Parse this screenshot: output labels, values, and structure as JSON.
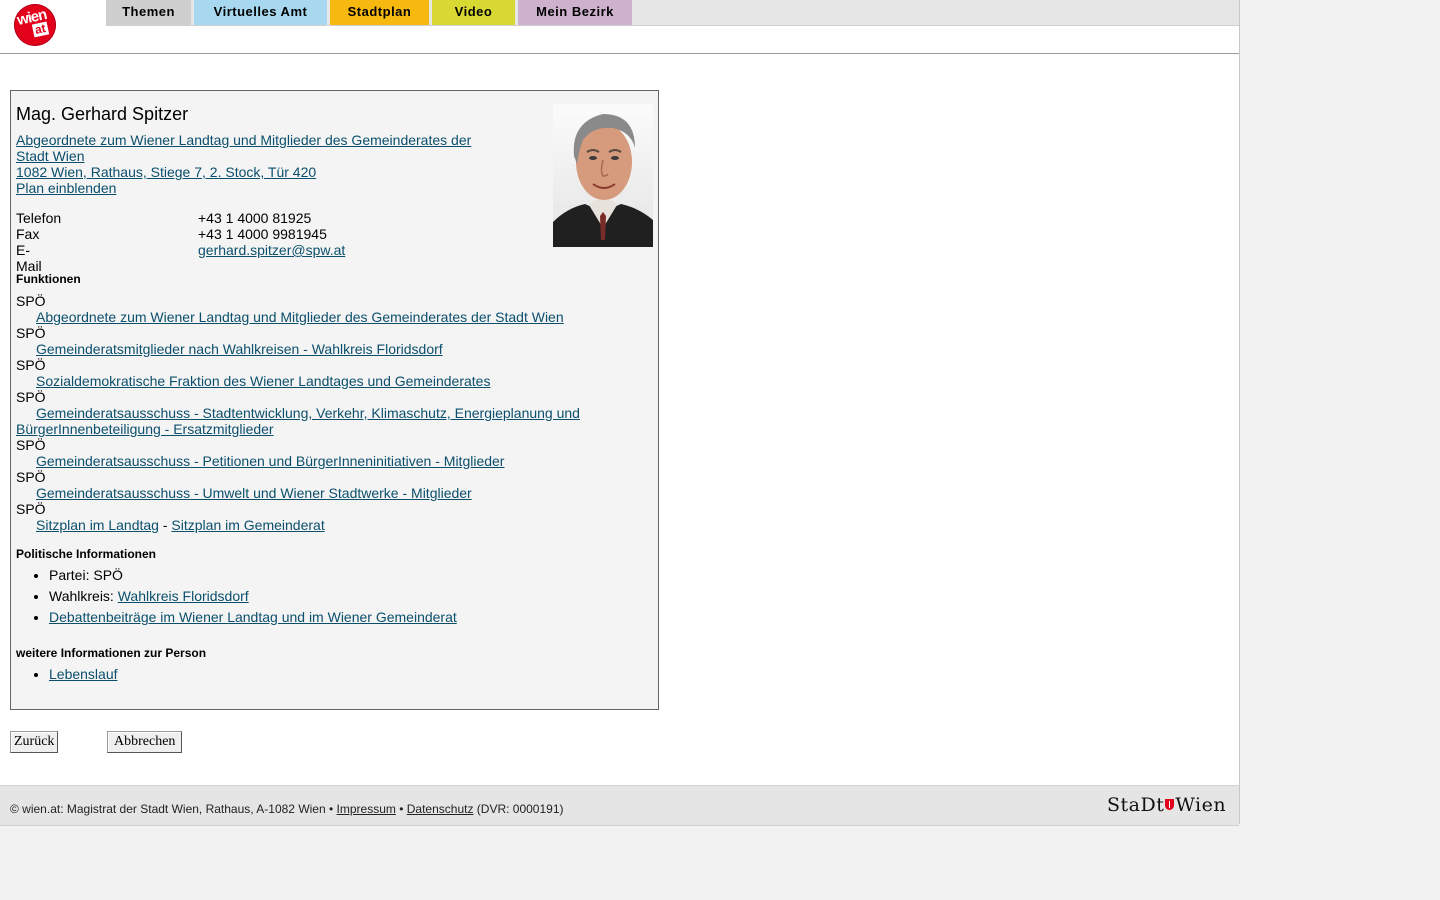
{
  "header": {
    "logo": {
      "line1": "wien",
      "line2": "at"
    },
    "nav": [
      {
        "label": "Themen",
        "color": "#cfcfcf"
      },
      {
        "label": "Virtuelles Amt",
        "color": "#a8d8f0"
      },
      {
        "label": "Stadtplan",
        "color": "#f7b90f"
      },
      {
        "label": "Video",
        "color": "#d7d932"
      },
      {
        "label": "Mein Bezirk",
        "color": "#ceb2cd"
      }
    ]
  },
  "person": {
    "name": "Mag. Gerhard Spitzer",
    "org_link": "Abgeordnete zum Wiener Landtag und Mitglieder des Gemeinderates der Stadt Wien",
    "address_link": "1082 Wien, Rathaus, Stiege 7, 2. Stock, Tür 420",
    "plan_link": "Plan einblenden",
    "contact": [
      {
        "label": "Telefon",
        "value": "+43 1 4000 81925"
      },
      {
        "label": "Fax",
        "value": "+43 1 4000 9981945"
      },
      {
        "label": "E-Mail",
        "value": "gerhard.spitzer@spw.at"
      }
    ]
  },
  "funktionen": {
    "heading": "Funktionen",
    "items": [
      {
        "party": "SPÖ",
        "link": "Abgeordnete zum Wiener Landtag und Mitglieder des Gemeinderates der Stadt Wien"
      },
      {
        "party": "SPÖ",
        "link": "Gemeinderatsmitglieder nach Wahlkreisen - Wahlkreis Floridsdorf"
      },
      {
        "party": "SPÖ",
        "link": "Sozialdemokratische Fraktion des Wiener Landtages und Gemeinderates"
      },
      {
        "party": "SPÖ",
        "link": "Gemeinderatsausschuss - Stadtentwicklung, Verkehr, Klimaschutz, Energieplanung und BürgerInnenbeteiligung - Ersatzmitglieder"
      },
      {
        "party": "SPÖ",
        "link": "Gemeinderatsausschuss - Petitionen und BürgerInneninitiativen - Mitglieder"
      },
      {
        "party": "SPÖ",
        "link": "Gemeinderatsausschuss - Umwelt und Wiener Stadtwerke - Mitglieder"
      }
    ],
    "last": {
      "party": "SPÖ",
      "link1": "Sitzplan im Landtag",
      "sep": " - ",
      "link2": "Sitzplan im Gemeinderat"
    }
  },
  "politisch": {
    "heading": "Politische Informationen",
    "partei_label": "Partei: SPÖ",
    "wahlkreis_label": "Wahlkreis: ",
    "wahlkreis_link": "Wahlkreis Floridsdorf",
    "debatten_link": "Debattenbeiträge im Wiener Landtag und im Wiener Gemeinderat"
  },
  "weitere": {
    "heading": "weitere Informationen zur Person",
    "lebenslauf_link": "Lebenslauf"
  },
  "buttons": {
    "back": "Zurück",
    "cancel": "Abbrechen"
  },
  "footer": {
    "text": "© wien.at: Magistrat der Stadt Wien, Rathaus, A-1082 Wien • ",
    "impressum": "Impressum",
    "sep": " • ",
    "datenschutz": "Datenschutz",
    "dvr": " (DVR: 0000191)",
    "logo_left": "StaDt",
    "logo_right": "Wien"
  }
}
